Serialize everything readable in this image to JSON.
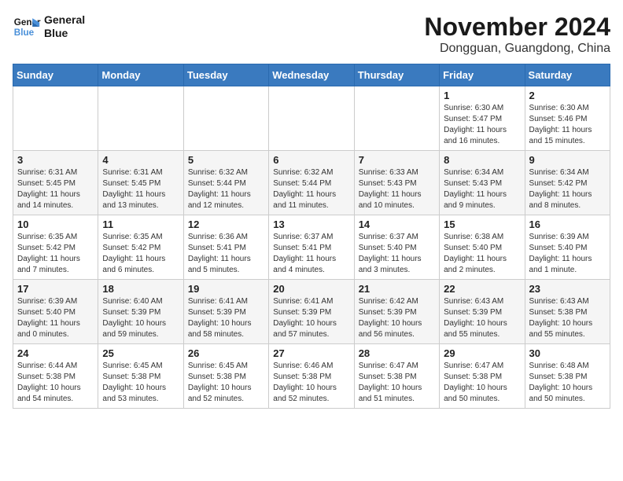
{
  "logo": {
    "line1": "General",
    "line2": "Blue"
  },
  "title": "November 2024",
  "subtitle": "Dongguan, Guangdong, China",
  "weekdays": [
    "Sunday",
    "Monday",
    "Tuesday",
    "Wednesday",
    "Thursday",
    "Friday",
    "Saturday"
  ],
  "weeks": [
    [
      {
        "day": "",
        "info": ""
      },
      {
        "day": "",
        "info": ""
      },
      {
        "day": "",
        "info": ""
      },
      {
        "day": "",
        "info": ""
      },
      {
        "day": "",
        "info": ""
      },
      {
        "day": "1",
        "info": "Sunrise: 6:30 AM\nSunset: 5:47 PM\nDaylight: 11 hours and 16 minutes."
      },
      {
        "day": "2",
        "info": "Sunrise: 6:30 AM\nSunset: 5:46 PM\nDaylight: 11 hours and 15 minutes."
      }
    ],
    [
      {
        "day": "3",
        "info": "Sunrise: 6:31 AM\nSunset: 5:45 PM\nDaylight: 11 hours and 14 minutes."
      },
      {
        "day": "4",
        "info": "Sunrise: 6:31 AM\nSunset: 5:45 PM\nDaylight: 11 hours and 13 minutes."
      },
      {
        "day": "5",
        "info": "Sunrise: 6:32 AM\nSunset: 5:44 PM\nDaylight: 11 hours and 12 minutes."
      },
      {
        "day": "6",
        "info": "Sunrise: 6:32 AM\nSunset: 5:44 PM\nDaylight: 11 hours and 11 minutes."
      },
      {
        "day": "7",
        "info": "Sunrise: 6:33 AM\nSunset: 5:43 PM\nDaylight: 11 hours and 10 minutes."
      },
      {
        "day": "8",
        "info": "Sunrise: 6:34 AM\nSunset: 5:43 PM\nDaylight: 11 hours and 9 minutes."
      },
      {
        "day": "9",
        "info": "Sunrise: 6:34 AM\nSunset: 5:42 PM\nDaylight: 11 hours and 8 minutes."
      }
    ],
    [
      {
        "day": "10",
        "info": "Sunrise: 6:35 AM\nSunset: 5:42 PM\nDaylight: 11 hours and 7 minutes."
      },
      {
        "day": "11",
        "info": "Sunrise: 6:35 AM\nSunset: 5:42 PM\nDaylight: 11 hours and 6 minutes."
      },
      {
        "day": "12",
        "info": "Sunrise: 6:36 AM\nSunset: 5:41 PM\nDaylight: 11 hours and 5 minutes."
      },
      {
        "day": "13",
        "info": "Sunrise: 6:37 AM\nSunset: 5:41 PM\nDaylight: 11 hours and 4 minutes."
      },
      {
        "day": "14",
        "info": "Sunrise: 6:37 AM\nSunset: 5:40 PM\nDaylight: 11 hours and 3 minutes."
      },
      {
        "day": "15",
        "info": "Sunrise: 6:38 AM\nSunset: 5:40 PM\nDaylight: 11 hours and 2 minutes."
      },
      {
        "day": "16",
        "info": "Sunrise: 6:39 AM\nSunset: 5:40 PM\nDaylight: 11 hours and 1 minute."
      }
    ],
    [
      {
        "day": "17",
        "info": "Sunrise: 6:39 AM\nSunset: 5:40 PM\nDaylight: 11 hours and 0 minutes."
      },
      {
        "day": "18",
        "info": "Sunrise: 6:40 AM\nSunset: 5:39 PM\nDaylight: 10 hours and 59 minutes."
      },
      {
        "day": "19",
        "info": "Sunrise: 6:41 AM\nSunset: 5:39 PM\nDaylight: 10 hours and 58 minutes."
      },
      {
        "day": "20",
        "info": "Sunrise: 6:41 AM\nSunset: 5:39 PM\nDaylight: 10 hours and 57 minutes."
      },
      {
        "day": "21",
        "info": "Sunrise: 6:42 AM\nSunset: 5:39 PM\nDaylight: 10 hours and 56 minutes."
      },
      {
        "day": "22",
        "info": "Sunrise: 6:43 AM\nSunset: 5:39 PM\nDaylight: 10 hours and 55 minutes."
      },
      {
        "day": "23",
        "info": "Sunrise: 6:43 AM\nSunset: 5:38 PM\nDaylight: 10 hours and 55 minutes."
      }
    ],
    [
      {
        "day": "24",
        "info": "Sunrise: 6:44 AM\nSunset: 5:38 PM\nDaylight: 10 hours and 54 minutes."
      },
      {
        "day": "25",
        "info": "Sunrise: 6:45 AM\nSunset: 5:38 PM\nDaylight: 10 hours and 53 minutes."
      },
      {
        "day": "26",
        "info": "Sunrise: 6:45 AM\nSunset: 5:38 PM\nDaylight: 10 hours and 52 minutes."
      },
      {
        "day": "27",
        "info": "Sunrise: 6:46 AM\nSunset: 5:38 PM\nDaylight: 10 hours and 52 minutes."
      },
      {
        "day": "28",
        "info": "Sunrise: 6:47 AM\nSunset: 5:38 PM\nDaylight: 10 hours and 51 minutes."
      },
      {
        "day": "29",
        "info": "Sunrise: 6:47 AM\nSunset: 5:38 PM\nDaylight: 10 hours and 50 minutes."
      },
      {
        "day": "30",
        "info": "Sunrise: 6:48 AM\nSunset: 5:38 PM\nDaylight: 10 hours and 50 minutes."
      }
    ]
  ]
}
